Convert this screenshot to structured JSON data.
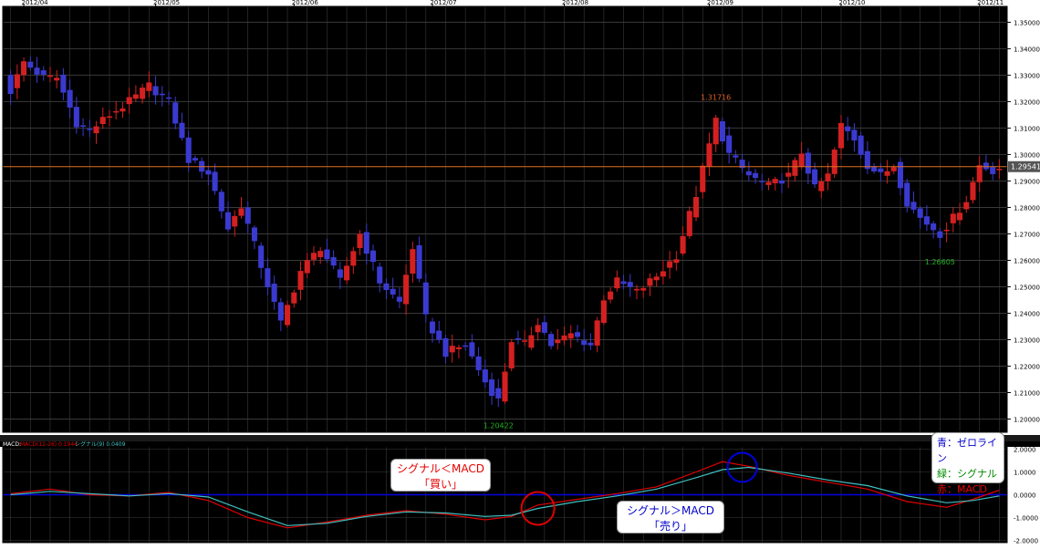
{
  "chart_data": [
    {
      "type": "candlestick",
      "x_ticks": [
        "2012/04",
        "2012/05",
        "2012/06",
        "2012/07",
        "2012/08",
        "2012/09",
        "2012/10",
        "2012/11"
      ],
      "y_ticks": [
        "1.35000",
        "1.34000",
        "1.33000",
        "1.32000",
        "1.31000",
        "1.30000",
        "1.29000",
        "1.28000",
        "1.27000",
        "1.26000",
        "1.25000",
        "1.24000",
        "1.23000",
        "1.22000",
        "1.21000",
        "1.20000"
      ],
      "ylim": [
        1.195,
        1.356
      ],
      "up_color": "#d42020",
      "down_color": "#3a3ad0",
      "current_price": {
        "value": 1.29541,
        "label": "1.29541",
        "line_color": "#e07020"
      },
      "annotations": [
        {
          "text": "1.31716",
          "value": 1.31716,
          "index": 107,
          "position": "above",
          "color": "#e06020"
        },
        {
          "text": "1.20422",
          "value": 1.20422,
          "index": 74,
          "position": "below",
          "color": "#20b020"
        },
        {
          "text": "1.26605",
          "value": 1.26605,
          "index": 141,
          "position": "below",
          "color": "#20b020"
        }
      ],
      "anchors": [
        {
          "i": 0,
          "c": 1.324
        },
        {
          "i": 2,
          "c": 1.335
        },
        {
          "i": 5,
          "c": 1.329
        },
        {
          "i": 7,
          "c": 1.329
        },
        {
          "i": 10,
          "c": 1.312
        },
        {
          "i": 12,
          "c": 1.309
        },
        {
          "i": 15,
          "c": 1.315
        },
        {
          "i": 18,
          "c": 1.32
        },
        {
          "i": 21,
          "c": 1.326
        },
        {
          "i": 24,
          "c": 1.32
        },
        {
          "i": 27,
          "c": 1.298
        },
        {
          "i": 30,
          "c": 1.293
        },
        {
          "i": 33,
          "c": 1.272
        },
        {
          "i": 35,
          "c": 1.281
        },
        {
          "i": 38,
          "c": 1.258
        },
        {
          "i": 41,
          "c": 1.236
        },
        {
          "i": 44,
          "c": 1.256
        },
        {
          "i": 47,
          "c": 1.265
        },
        {
          "i": 50,
          "c": 1.252
        },
        {
          "i": 53,
          "c": 1.27
        },
        {
          "i": 56,
          "c": 1.252
        },
        {
          "i": 59,
          "c": 1.244
        },
        {
          "i": 61,
          "c": 1.265
        },
        {
          "i": 63,
          "c": 1.238
        },
        {
          "i": 66,
          "c": 1.225
        },
        {
          "i": 69,
          "c": 1.228
        },
        {
          "i": 72,
          "c": 1.214
        },
        {
          "i": 74,
          "c": 1.207
        },
        {
          "i": 76,
          "c": 1.23
        },
        {
          "i": 78,
          "c": 1.228
        },
        {
          "i": 80,
          "c": 1.237
        },
        {
          "i": 82,
          "c": 1.228
        },
        {
          "i": 85,
          "c": 1.232
        },
        {
          "i": 88,
          "c": 1.228
        },
        {
          "i": 90,
          "c": 1.246
        },
        {
          "i": 92,
          "c": 1.252
        },
        {
          "i": 95,
          "c": 1.248
        },
        {
          "i": 98,
          "c": 1.254
        },
        {
          "i": 101,
          "c": 1.262
        },
        {
          "i": 104,
          "c": 1.285
        },
        {
          "i": 107,
          "c": 1.313
        },
        {
          "i": 109,
          "c": 1.3
        },
        {
          "i": 112,
          "c": 1.292
        },
        {
          "i": 115,
          "c": 1.288
        },
        {
          "i": 118,
          "c": 1.292
        },
        {
          "i": 120,
          "c": 1.301
        },
        {
          "i": 122,
          "c": 1.287
        },
        {
          "i": 124,
          "c": 1.292
        },
        {
          "i": 126,
          "c": 1.311
        },
        {
          "i": 128,
          "c": 1.306
        },
        {
          "i": 130,
          "c": 1.296
        },
        {
          "i": 132,
          "c": 1.292
        },
        {
          "i": 134,
          "c": 1.296
        },
        {
          "i": 136,
          "c": 1.282
        },
        {
          "i": 138,
          "c": 1.276
        },
        {
          "i": 141,
          "c": 1.27
        },
        {
          "i": 143,
          "c": 1.276
        },
        {
          "i": 145,
          "c": 1.283
        },
        {
          "i": 147,
          "c": 1.296
        },
        {
          "i": 149,
          "c": 1.294
        },
        {
          "i": 150,
          "c": 1.295
        }
      ]
    },
    {
      "type": "line",
      "header": "MACD:",
      "macd_label": "MACD(12-26) 0.1944",
      "signal_label": "シグナル(9) 0.0409",
      "y_ticks": [
        "2.0000",
        "1.0000",
        "0.0000",
        "-1.0000",
        "-2.0000"
      ],
      "ylim": [
        -2.1,
        2.1
      ],
      "zero_line": 0,
      "series": [
        {
          "name": "MACD",
          "color": "#e00000",
          "points": [
            [
              0,
              0.05
            ],
            [
              6,
              0.25
            ],
            [
              12,
              0.0
            ],
            [
              18,
              -0.05
            ],
            [
              24,
              0.1
            ],
            [
              30,
              -0.25
            ],
            [
              36,
              -1.0
            ],
            [
              42,
              -1.45
            ],
            [
              48,
              -1.2
            ],
            [
              54,
              -0.9
            ],
            [
              60,
              -0.7
            ],
            [
              66,
              -0.85
            ],
            [
              72,
              -1.1
            ],
            [
              76,
              -0.95
            ],
            [
              80,
              -0.45
            ],
            [
              86,
              -0.2
            ],
            [
              92,
              0.05
            ],
            [
              98,
              0.35
            ],
            [
              104,
              1.0
            ],
            [
              108,
              1.45
            ],
            [
              112,
              1.25
            ],
            [
              118,
              0.85
            ],
            [
              124,
              0.55
            ],
            [
              130,
              0.25
            ],
            [
              136,
              -0.3
            ],
            [
              142,
              -0.55
            ],
            [
              146,
              -0.2
            ],
            [
              150,
              0.2
            ]
          ]
        },
        {
          "name": "シグナル",
          "color": "#40c0c0",
          "points": [
            [
              0,
              0.0
            ],
            [
              6,
              0.15
            ],
            [
              12,
              0.05
            ],
            [
              18,
              -0.05
            ],
            [
              24,
              0.05
            ],
            [
              30,
              -0.1
            ],
            [
              36,
              -0.75
            ],
            [
              42,
              -1.35
            ],
            [
              48,
              -1.25
            ],
            [
              54,
              -0.95
            ],
            [
              60,
              -0.75
            ],
            [
              66,
              -0.8
            ],
            [
              72,
              -0.95
            ],
            [
              76,
              -0.9
            ],
            [
              80,
              -0.6
            ],
            [
              86,
              -0.3
            ],
            [
              92,
              -0.05
            ],
            [
              98,
              0.25
            ],
            [
              104,
              0.75
            ],
            [
              108,
              1.1
            ],
            [
              112,
              1.2
            ],
            [
              118,
              0.95
            ],
            [
              124,
              0.65
            ],
            [
              130,
              0.4
            ],
            [
              136,
              -0.05
            ],
            [
              142,
              -0.35
            ],
            [
              146,
              -0.25
            ],
            [
              150,
              -0.05
            ]
          ]
        }
      ]
    }
  ],
  "callouts": {
    "buy_line1": "シグナル＜MACD",
    "buy_line2": "「買い」",
    "sell_line1": "シグナル＞MACD",
    "sell_line2": "「売り」"
  },
  "legend": {
    "zero_line": "青：ゼロライン",
    "signal": "緑：シグナル",
    "macd": "赤：MACD"
  },
  "colors": {
    "background": "#000000",
    "grid": "#3a3a3a",
    "axis_panel": "#ffffff",
    "zero_line": "#0000e0",
    "circle_buy": "#e00000",
    "circle_sell": "#0000e0"
  }
}
